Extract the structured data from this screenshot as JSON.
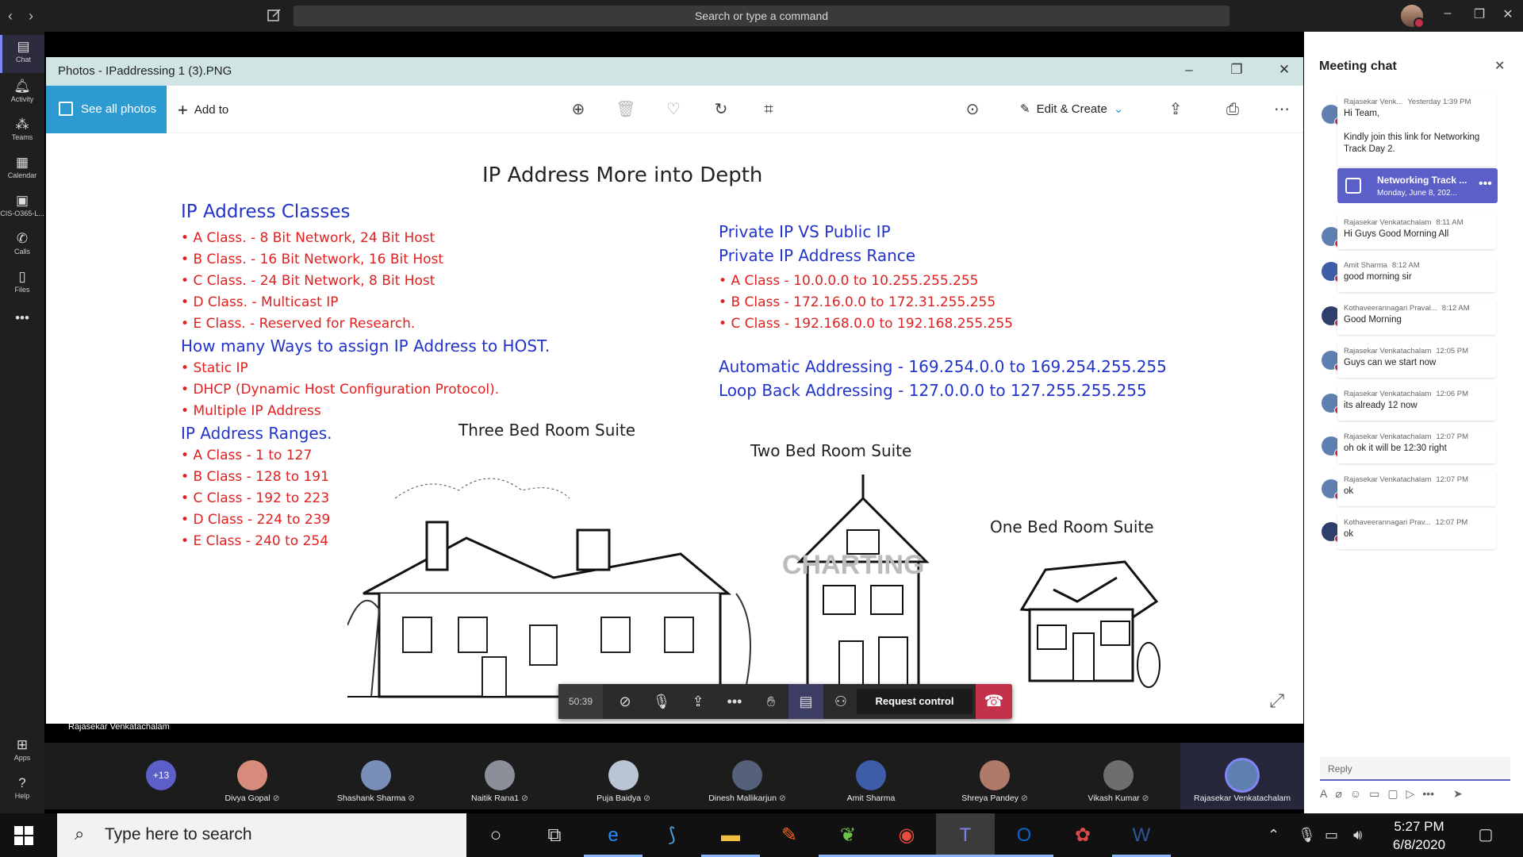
{
  "titlebar": {
    "search_placeholder": "Search or type a command",
    "back_icon": "chevron-left-icon",
    "forward_icon": "chevron-right-icon"
  },
  "rail": {
    "items": [
      {
        "label": "Chat",
        "icon": "chat-icon"
      },
      {
        "label": "Activity",
        "icon": "bell-icon"
      },
      {
        "label": "Teams",
        "icon": "teams-icon"
      },
      {
        "label": "Calendar",
        "icon": "calendar-icon"
      },
      {
        "label": "CIS-O365-L...",
        "icon": "app-icon"
      },
      {
        "label": "Calls",
        "icon": "phone-icon"
      },
      {
        "label": "Files",
        "icon": "file-icon"
      },
      {
        "label": "Apps",
        "icon": "apps-icon"
      },
      {
        "label": "Help",
        "icon": "help-icon"
      }
    ]
  },
  "photos": {
    "title": "Photos - IPaddressing 1 (3).PNG",
    "see_all": "See all photos",
    "add_to": "Add to",
    "edit_create": "Edit & Create"
  },
  "slide": {
    "title": "IP Address More into Depth",
    "classes_heading": "IP Address Classes",
    "classes": [
      "A Class.    -    8 Bit Network, 24 Bit Host",
      "B Class.    -    16 Bit Network, 16 Bit Host",
      "C Class.    -    24 Bit Network, 8 Bit Host",
      "D Class.    -    Multicast IP",
      "E Class.    -    Reserved for Research."
    ],
    "assign_heading": "How many Ways to assign IP Address to HOST.",
    "assign": [
      "Static IP",
      "DHCP (Dynamic Host Configuration Protocol).",
      "Multiple IP Address"
    ],
    "ranges_heading": "IP Address Ranges.",
    "ranges": [
      "A Class - 1 to 127",
      "B Class - 128 to 191",
      "C Class - 192 to 223",
      "D Class - 224 to 239",
      "E Class - 240 to 254"
    ],
    "private_heading_1": "Private IP VS Public IP",
    "private_heading_2": "Private IP Address Rance",
    "private": [
      "A Class - 10.0.0.0 to 10.255.255.255",
      "B Class - 172.16.0.0 to 172.31.255.255",
      "C Class - 192.168.0.0 to 192.168.255.255"
    ],
    "auto_addr": "Automatic Addressing  -  169.254.0.0 to 169.254.255.255",
    "loopback": "Loop Back Addressing  -  127.0.0.0  to 127.255.255.255",
    "caption_three": "Three Bed Room Suite",
    "caption_two": "Two Bed Room Suite",
    "caption_one": "One Bed Room Suite"
  },
  "callbar": {
    "timer": "50:39",
    "request_control": "Request control"
  },
  "presenter": "Rajasekar Venkatachalam",
  "participants": {
    "more": "+13",
    "list": [
      {
        "name": "Divya Gopal",
        "color": "#d78b7a"
      },
      {
        "name": "Shashank Sharma",
        "color": "#7a8fb8"
      },
      {
        "name": "Naitik Rana1",
        "color": "#8a8f9a"
      },
      {
        "name": "Puja Baidya",
        "color": "#b9c4d4"
      },
      {
        "name": "Dinesh Mallikarjun",
        "color": "#55617a"
      },
      {
        "name": "Amit Sharma",
        "color": "#3e5da8"
      },
      {
        "name": "Shreya Pandey",
        "color": "#b07a6a"
      },
      {
        "name": "Vikash Kumar",
        "color": "#6e6e6e"
      },
      {
        "name": "Rajasekar Venkatachalam",
        "color": "#5f7fb0"
      }
    ]
  },
  "chat": {
    "title": "Meeting chat",
    "messages": [
      {
        "sender": "Rajasekar Venk...",
        "time": "Yesterday 1:39 PM",
        "text": "Hi Team,\n\nKindly join this link for Networking Track Day 2."
      },
      {
        "sender": "Rajasekar Venkatachalam",
        "time": "8:11 AM",
        "text": "Hi Guys Good Morning All"
      },
      {
        "sender": "Amit Sharma",
        "time": "8:12 AM",
        "text": "good morning sir"
      },
      {
        "sender": "Kothaveerannagari Praval...",
        "time": "8:12 AM",
        "text": "Good Morning"
      },
      {
        "sender": "Rajasekar Venkatachalam",
        "time": "12:05 PM",
        "text": "Guys can we start now"
      },
      {
        "sender": "Rajasekar Venkatachalam",
        "time": "12:06 PM",
        "text": "its already 12 now"
      },
      {
        "sender": "Rajasekar Venkatachalam",
        "time": "12:07 PM",
        "text": "oh ok it will be 12:30 right"
      },
      {
        "sender": "Rajasekar Venkatachalam",
        "time": "12:07 PM",
        "text": "ok"
      },
      {
        "sender": "Kothaveerannagari Prav...",
        "time": "12:07 PM",
        "text": "ok"
      }
    ],
    "meeting_card": {
      "title": "Networking Track ...",
      "date": "Monday, June 8, 202..."
    },
    "reply_placeholder": "Reply"
  },
  "taskbar": {
    "search_placeholder": "Type here to search",
    "time": "5:27 PM",
    "date": "6/8/2020"
  }
}
